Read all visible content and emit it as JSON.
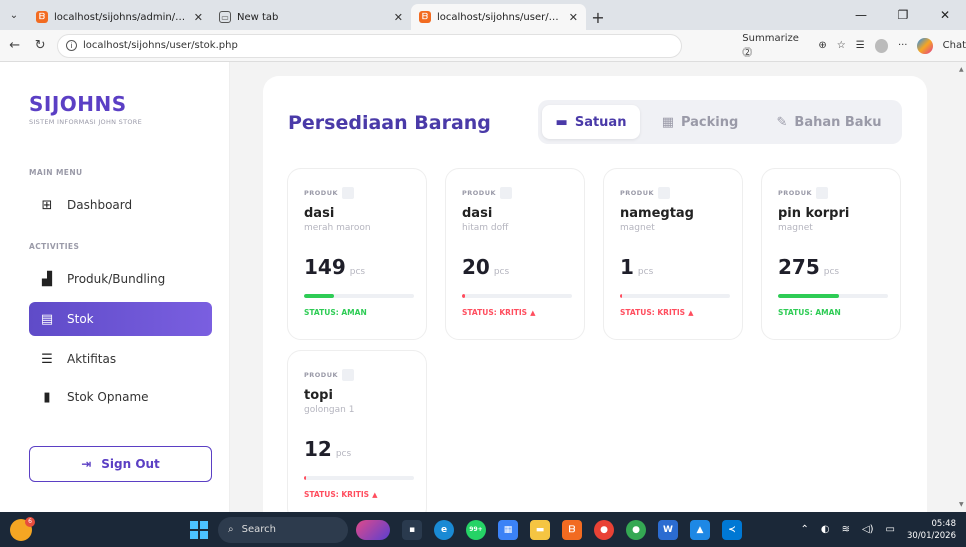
{
  "browser": {
    "tabs": [
      {
        "title": "localhost/sijohns/admin/index.php",
        "favicon": "xampp-icon",
        "active": false
      },
      {
        "title": "New tab",
        "favicon": "newtab-icon",
        "active": false
      },
      {
        "title": "localhost/sijohns/user/stok.php",
        "favicon": "xampp-icon",
        "active": true
      }
    ],
    "url": "localhost/sijohns/user/stok.php",
    "summarize_label": "Summarize",
    "chat_label": "Chat"
  },
  "sidebar": {
    "brand": "SIJOHNS",
    "brand_sub": "SISTEM INFORMASI JOHN STORE",
    "section_main": "MAIN MENU",
    "section_activities": "ACTIVITIES",
    "items": [
      {
        "label": "Dashboard",
        "icon": "dashboard-icon"
      },
      {
        "label": "Produk/Bundling",
        "icon": "boxes-icon"
      },
      {
        "label": "Stok",
        "icon": "warehouse-icon",
        "active": true
      },
      {
        "label": "Aktifitas",
        "icon": "list-check-icon"
      },
      {
        "label": "Stok Opname",
        "icon": "clipboard-icon"
      }
    ],
    "signout_label": "Sign Out"
  },
  "main": {
    "title": "Persediaan Barang",
    "segments": [
      {
        "label": "Satuan",
        "icon": "box-icon",
        "active": true
      },
      {
        "label": "Packing",
        "icon": "boxes-stack-icon",
        "active": false
      },
      {
        "label": "Bahan Baku",
        "icon": "tool-icon",
        "active": false
      }
    ],
    "product_tag": "PRODUK",
    "unit": "pcs",
    "cards": [
      {
        "name": "dasi",
        "variant": "merah maroon",
        "qty": "149",
        "status": "STATUS: AMAN",
        "level": 0.27,
        "state": "aman"
      },
      {
        "name": "dasi",
        "variant": "hitam doff",
        "qty": "20",
        "status": "STATUS: KRITIS",
        "level": 0.03,
        "state": "kritis"
      },
      {
        "name": "namegtag",
        "variant": "magnet",
        "qty": "1",
        "status": "STATUS: KRITIS",
        "level": 0.005,
        "state": "kritis"
      },
      {
        "name": "pin korpri",
        "variant": "magnet",
        "qty": "275",
        "status": "STATUS: AMAN",
        "level": 0.55,
        "state": "aman"
      },
      {
        "name": "topi",
        "variant": "golongan 1",
        "qty": "12",
        "status": "STATUS: KRITIS",
        "level": 0.02,
        "state": "kritis"
      }
    ],
    "colors": {
      "aman": "#2ecc55",
      "kritis": "#ff4d5e"
    }
  },
  "taskbar": {
    "search_label": "Search",
    "weather_badge": "6",
    "whatsapp_badge": "99+",
    "time": "05:48",
    "date": "30/01/2026"
  }
}
